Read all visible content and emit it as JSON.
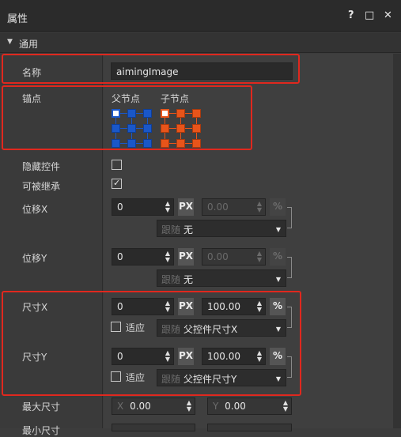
{
  "window": {
    "title": "属性",
    "help": "?",
    "maximize": "□",
    "close": "✕"
  },
  "section": {
    "arrow": "▼",
    "label": "通用"
  },
  "name": {
    "label": "名称",
    "value": "aimingImage"
  },
  "anchor": {
    "label": "锚点",
    "parent_label": "父节点",
    "child_label": "子节点"
  },
  "hide": {
    "label": "隐藏控件",
    "checked": false
  },
  "inherit": {
    "label": "可被继承",
    "checked": true,
    "mark": "✓"
  },
  "posX": {
    "label": "位移X",
    "value": "0",
    "pct_value": "0.00",
    "unit_px": "PX",
    "unit_pct": "%",
    "follow_prefix": "跟随",
    "follow_value": "无"
  },
  "posY": {
    "label": "位移Y",
    "value": "0",
    "pct_value": "0.00",
    "unit_px": "PX",
    "unit_pct": "%",
    "follow_prefix": "跟随",
    "follow_value": "无"
  },
  "sizeX": {
    "label": "尺寸X",
    "value": "0",
    "pct_value": "100.00",
    "unit_px": "PX",
    "unit_pct": "%",
    "adapt_label": "适应",
    "follow_prefix": "跟随",
    "follow_value": "父控件尺寸X"
  },
  "sizeY": {
    "label": "尺寸Y",
    "value": "0",
    "pct_value": "100.00",
    "unit_px": "PX",
    "unit_pct": "%",
    "adapt_label": "适应",
    "follow_prefix": "跟随",
    "follow_value": "父控件尺寸Y"
  },
  "maxSize": {
    "label": "最大尺寸",
    "x_prefix": "X",
    "x_value": "0.00",
    "y_prefix": "Y",
    "y_value": "0.00"
  },
  "minSize": {
    "label": "最小尺寸"
  },
  "colors": {
    "highlight_box": "#e0281e",
    "parent_anchor": "#1a57c8",
    "child_anchor": "#e8541a"
  },
  "icons": {
    "spin": "up-down-arrows",
    "dropdown": "caret-down"
  }
}
